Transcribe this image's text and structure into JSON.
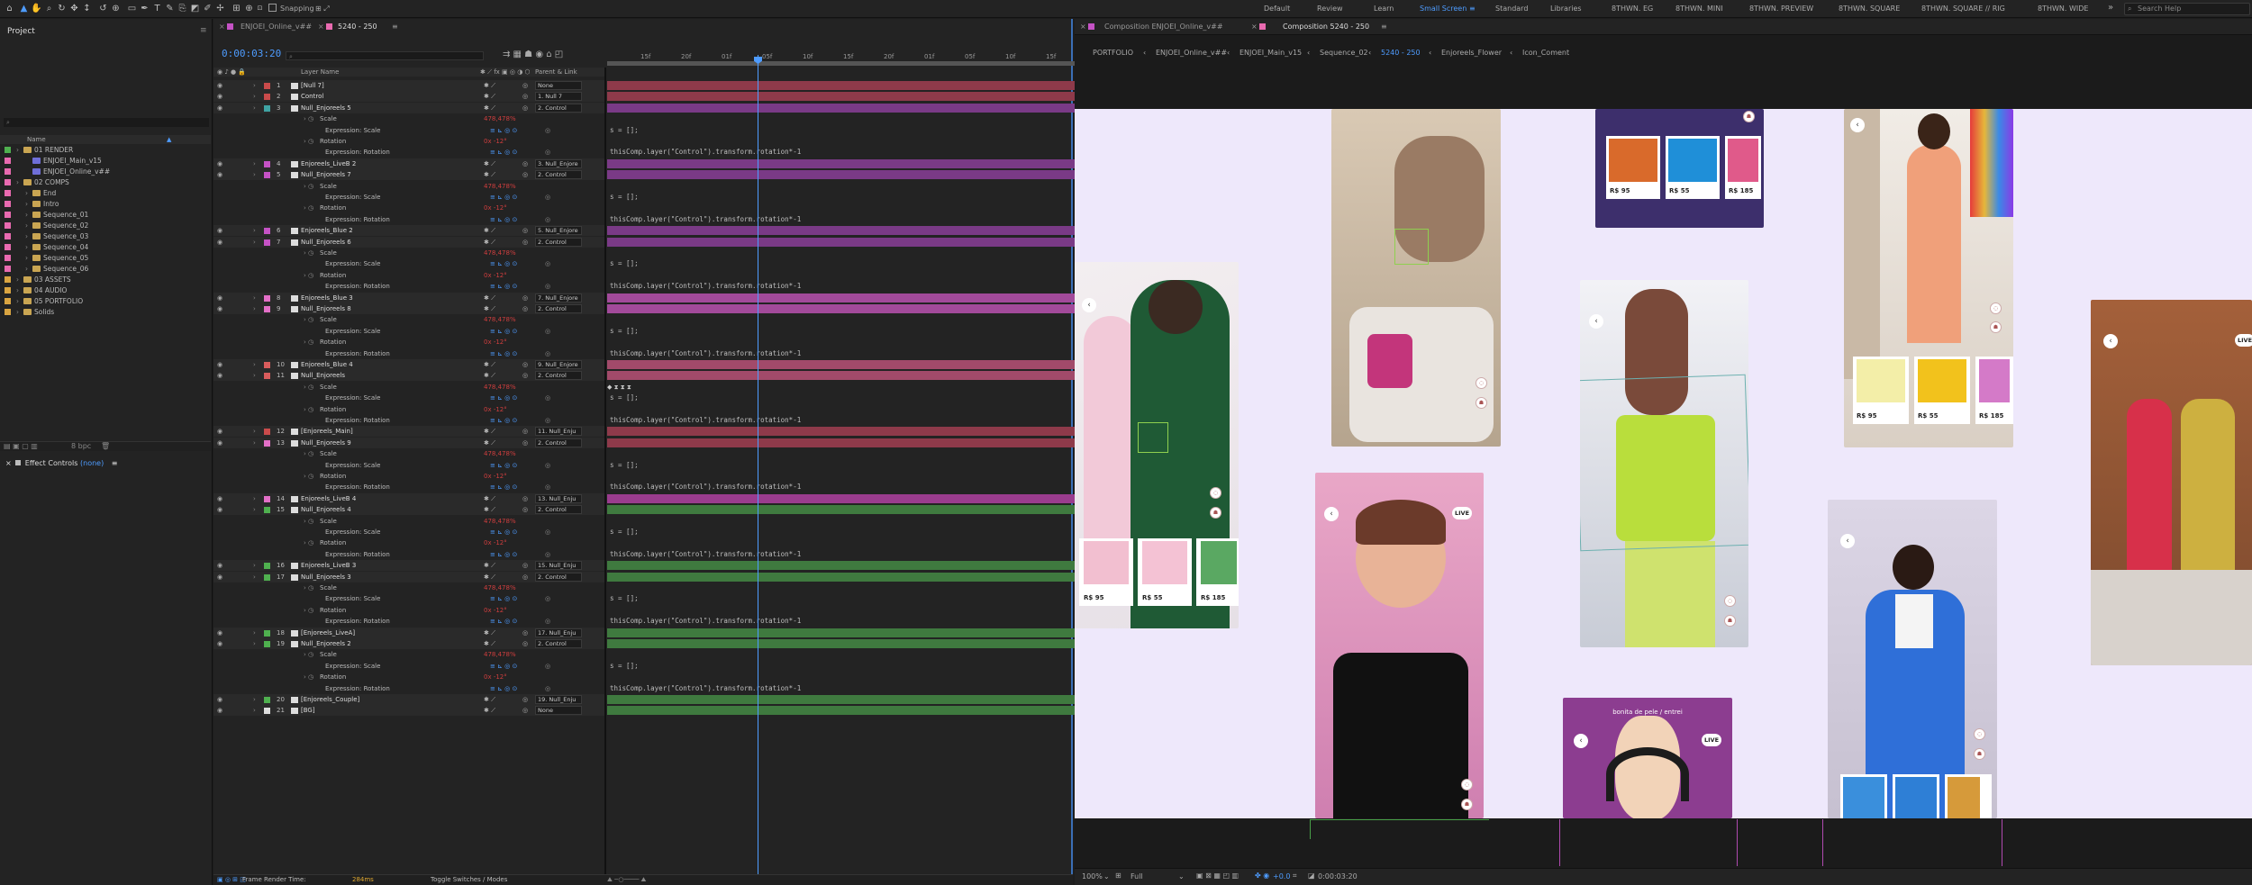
{
  "toolbar": {
    "snapping": "Snapping",
    "workspaces": [
      "Default",
      "Review",
      "Learn",
      "Small Screen",
      "Standard",
      "Libraries",
      "8THWN. EG",
      "8THWN. MINI",
      "8THWN. PREVIEW",
      "8THWN. SQUARE",
      "8THWN. SQUARE // RIG",
      "8THWN. WIDE"
    ],
    "active_workspace": "Small Screen",
    "search_placeholder": "Search Help",
    "more": "»"
  },
  "project": {
    "title": "Project",
    "col_name": "Name",
    "items": [
      {
        "label": "01 RENDER",
        "type": "folder",
        "color": "#4fb04f"
      },
      {
        "label": "ENJOEI_Main_v15",
        "type": "comp",
        "color": "#e96ab0"
      },
      {
        "label": "ENJOEI_Online_v##",
        "type": "comp",
        "color": "#e96ab0"
      },
      {
        "label": "02 COMPS",
        "type": "folder",
        "color": "#e96ab0"
      },
      {
        "label": "End",
        "type": "folder",
        "color": "#e96ab0"
      },
      {
        "label": "Intro",
        "type": "folder",
        "color": "#e96ab0"
      },
      {
        "label": "Sequence_01",
        "type": "folder",
        "color": "#e96ab0"
      },
      {
        "label": "Sequence_02",
        "type": "folder",
        "color": "#e96ab0"
      },
      {
        "label": "Sequence_03",
        "type": "folder",
        "color": "#e96ab0"
      },
      {
        "label": "Sequence_04",
        "type": "folder",
        "color": "#e96ab0"
      },
      {
        "label": "Sequence_05",
        "type": "folder",
        "color": "#e96ab0"
      },
      {
        "label": "Sequence_06",
        "type": "folder",
        "color": "#e96ab0"
      },
      {
        "label": "03 ASSETS",
        "type": "folder",
        "color": "#d9a441"
      },
      {
        "label": "04 AUDIO",
        "type": "folder",
        "color": "#d9a441"
      },
      {
        "label": "05 PORTFOLIO",
        "type": "folder",
        "color": "#d9a441"
      },
      {
        "label": "Solids",
        "type": "folder",
        "color": "#d9a441"
      }
    ],
    "bpc": "8 bpc"
  },
  "effect_controls": {
    "title": "Effect Controls",
    "value": "(none)"
  },
  "timeline": {
    "tabs": [
      "ENJOEI_Online_v##",
      "5240 - 250"
    ],
    "active_tab": "5240 - 250",
    "timecode": "0:00:03:20",
    "search_placeholder": "",
    "col_layer_name": "Layer Name",
    "col_parent": "Parent & Link",
    "ruler": [
      "15f",
      "20f",
      "01f",
      "05f",
      "10f",
      "15f",
      "20f",
      "01f",
      "05f",
      "10f",
      "15f",
      "20f",
      "01f"
    ],
    "layers": [
      {
        "num": "1",
        "name": "[Null 7]",
        "color": "#c94b4b",
        "parent": "None",
        "bar": "#8e3a4a"
      },
      {
        "num": "2",
        "name": "Control",
        "color": "#c94b4b",
        "parent": "1. Null 7",
        "bar": "#8e3a4a"
      },
      {
        "num": "3",
        "name": "Null_Enjoreels 5",
        "color": "#3fa3a3",
        "parent": "2. Control",
        "bar": "#7a3a86"
      },
      {
        "num": "4",
        "name": "Enjoreels_LiveB 2",
        "color": "#c552c5",
        "parent": "3. Null_Enjore",
        "bar": "#7a3a86"
      },
      {
        "num": "5",
        "name": "Null_Enjoreels 7",
        "color": "#c552c5",
        "parent": "2. Control",
        "bar": "#7a3a86"
      },
      {
        "num": "6",
        "name": "Enjoreels_Blue 2",
        "color": "#c552c5",
        "parent": "5. Null_Enjore",
        "bar": "#7a3a86"
      },
      {
        "num": "7",
        "name": "Null_Enjoreels 6",
        "color": "#c552c5",
        "parent": "2. Control",
        "bar": "#7a3a86"
      },
      {
        "num": "8",
        "name": "Enjoreels_Blue 3",
        "color": "#e36fc7",
        "parent": "7. Null_Enjore",
        "bar": "#a24a9a"
      },
      {
        "num": "9",
        "name": "Null_Enjoreels 8",
        "color": "#e36fc7",
        "parent": "2. Control",
        "bar": "#a24a9a"
      },
      {
        "num": "10",
        "name": "Enjoreels_Blue 4",
        "color": "#d95c5c",
        "parent": "9. Null_Enjore",
        "bar": "#a24a6a"
      },
      {
        "num": "11",
        "name": "Null_Enjoreels",
        "color": "#d95c5c",
        "parent": "2. Control",
        "bar": "#a24a6a"
      },
      {
        "num": "12",
        "name": "[Enjoreels_Main]",
        "color": "#c94b4b",
        "parent": "11. Null_Enju",
        "bar": "#8e3a4a"
      },
      {
        "num": "13",
        "name": "Null_Enjoreels 9",
        "color": "#e36fc7",
        "parent": "2. Control",
        "bar": "#8e3a4a"
      },
      {
        "num": "14",
        "name": "Enjoreels_LiveB 4",
        "color": "#e36fc7",
        "parent": "13. Null_Enju",
        "bar": "#9a3c8e"
      },
      {
        "num": "15",
        "name": "Null_Enjoreels 4",
        "color": "#4fb04f",
        "parent": "2. Control",
        "bar": "#3f7a3f"
      },
      {
        "num": "16",
        "name": "Enjoreels_LiveB 3",
        "color": "#4fb04f",
        "parent": "15. Null_Enju",
        "bar": "#3f7a3f"
      },
      {
        "num": "17",
        "name": "Null_Enjoreels 3",
        "color": "#4fb04f",
        "parent": "2. Control",
        "bar": "#3f7a3f"
      },
      {
        "num": "18",
        "name": "[Enjoreels_LiveA]",
        "color": "#4fb04f",
        "parent": "17. Null_Enju",
        "bar": "#3f7a3f"
      },
      {
        "num": "19",
        "name": "Null_Enjoreels 2",
        "color": "#4fb04f",
        "parent": "2. Control",
        "bar": "#3f7a3f"
      },
      {
        "num": "20",
        "name": "[Enjoreels_Couple]",
        "color": "#4fb04f",
        "parent": "19. Null_Enju",
        "bar": "#3f7a3f"
      },
      {
        "num": "21",
        "name": "[BG]",
        "color": "#dddddd",
        "parent": "None",
        "bar": "#3f7a3f"
      }
    ],
    "prop_scale": "Scale",
    "prop_expr_scale": "Expression: Scale",
    "prop_rotation": "Rotation",
    "prop_expr_rotation": "Expression: Rotation",
    "scale_value": "478,478%",
    "rotation_value": "0x -12°",
    "expr_scale": "s = [];",
    "expr_rotation": "thisComp.layer(\"Control\").transform.rotation*-1",
    "footer_render": "Frame Render Time:",
    "footer_render_value": "284ms",
    "footer_toggle": "Toggle Switches / Modes"
  },
  "composition": {
    "tabs": [
      "Composition ENJOEI_Online_v##",
      "Composition 5240 - 250"
    ],
    "breadcrumbs": [
      "PORTFOLIO",
      "ENJOEI_Online_v##",
      "ENJOEI_Main_v15",
      "Sequence_02",
      "5240 - 250",
      "Enjoreels_Flower",
      "Icon_Coment"
    ],
    "active_breadcrumb": "5240 - 250",
    "cards": {
      "prices": [
        "R$ 95",
        "R$ 55",
        "R$ 185"
      ],
      "live": "LIVE",
      "caption": "bonita de pele / entrei"
    },
    "zoom": "100%",
    "resolution": "Full",
    "exposure": "+0.0",
    "timecode": "0:00:03:20"
  }
}
